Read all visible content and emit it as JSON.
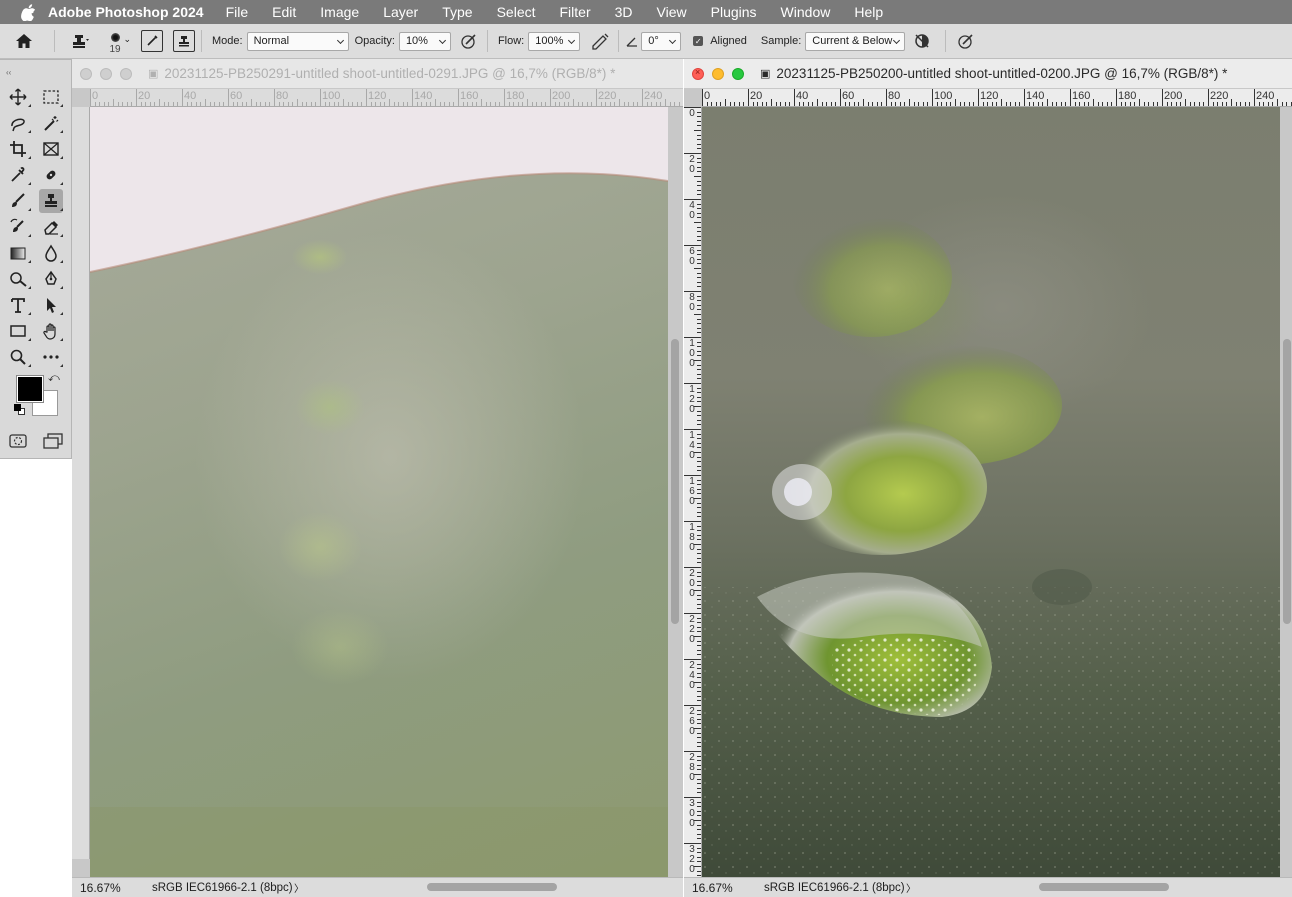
{
  "menubar": {
    "app_name": "Adobe Photoshop 2024",
    "items": [
      "File",
      "Edit",
      "Image",
      "Layer",
      "Type",
      "Select",
      "Filter",
      "3D",
      "View",
      "Plugins",
      "Window",
      "Help"
    ]
  },
  "options": {
    "brush_size": "19",
    "mode_label": "Mode:",
    "mode_value": "Normal",
    "opacity_label": "Opacity:",
    "opacity_value": "10%",
    "flow_label": "Flow:",
    "flow_value": "100%",
    "angle_value": "0°",
    "aligned_checked": true,
    "aligned_label": "Aligned",
    "sample_label": "Sample:",
    "sample_value": "Current & Below"
  },
  "toolbar": {
    "rows": [
      [
        "move-icon",
        "marquee-icon"
      ],
      [
        "lasso-icon",
        "magic-wand-icon"
      ],
      [
        "crop-icon",
        "frame-icon"
      ],
      [
        "eyedropper-icon",
        "healing-brush-icon"
      ],
      [
        "brush-icon",
        "clone-stamp-icon"
      ],
      [
        "history-brush-icon",
        "eraser-icon"
      ],
      [
        "gradient-icon",
        "blur-icon"
      ],
      [
        "dodge-icon",
        "pen-icon"
      ],
      [
        "type-icon",
        "path-selection-icon"
      ],
      [
        "rectangle-icon",
        "hand-icon"
      ],
      [
        "zoom-icon",
        "more-tools-icon"
      ]
    ],
    "active_tool": "clone-stamp-icon",
    "foreground_color": "#000000",
    "background_color": "#ffffff"
  },
  "doc_left": {
    "title": "20231125-PB250291-untitled shoot-untitled-0291.JPG @ 16,7% (RGB/8*) *",
    "zoom": "16.67%",
    "profile": "sRGB IEC61966-2.1 (8bpc)",
    "chevron": "〉",
    "ruler_h": [
      "0",
      "20",
      "40",
      "60",
      "80",
      "100",
      "120",
      "140",
      "160",
      "180",
      "200",
      "220",
      "240"
    ]
  },
  "doc_right": {
    "title": "20231125-PB250200-untitled shoot-untitled-0200.JPG @ 16,7% (RGB/8*) *",
    "zoom": "16.67%",
    "profile": "sRGB IEC61966-2.1 (8bpc)",
    "chevron": "〉",
    "ruler_h": [
      "0",
      "20",
      "40",
      "60",
      "80",
      "100",
      "120",
      "140",
      "160",
      "180",
      "200",
      "220",
      "240"
    ],
    "ruler_v": [
      "0",
      "20",
      "40",
      "60",
      "80",
      "100",
      "120",
      "140",
      "160",
      "180",
      "200",
      "220",
      "240",
      "260",
      "280",
      "300",
      "320"
    ]
  },
  "colors": {
    "menubar": "#7a7a7a",
    "close": "#fe5f57",
    "minimize": "#febc2e",
    "zoom": "#28c840"
  }
}
